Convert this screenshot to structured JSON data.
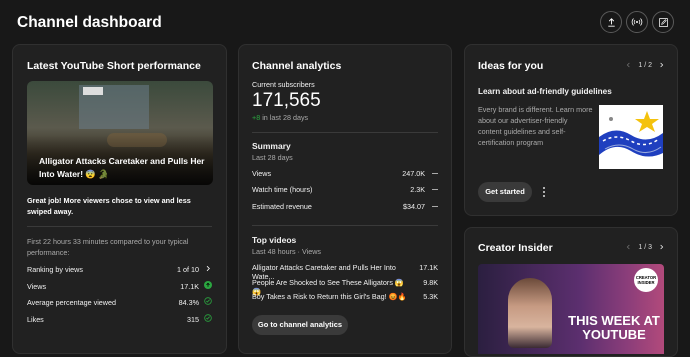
{
  "header": {
    "title": "Channel dashboard",
    "buttons": [
      "upload-icon",
      "live-icon",
      "edit-icon"
    ]
  },
  "short": {
    "title": "Latest YouTube Short performance",
    "thumbnail_caption": "Alligator Attacks Caretaker and Pulls Her Into Water! 😨 🐊",
    "summary": "Great job! More viewers chose to view and less swiped away.",
    "compare": "First 22 hours 33 minutes compared to your typical performance:",
    "stats": [
      {
        "label": "Ranking by views",
        "value": "1 of 10"
      },
      {
        "label": "Views",
        "value": "17.1K"
      },
      {
        "label": "Average percentage viewed",
        "value": "84.3%"
      },
      {
        "label": "Likes",
        "value": "315"
      }
    ]
  },
  "analytics": {
    "title": "Channel analytics",
    "subs_label": "Current subscribers",
    "subs_value": "171,565",
    "subs_change": "+8",
    "subs_period": "in last 28 days",
    "summary_title": "Summary",
    "summary_period": "Last 28 days",
    "summary_rows": [
      {
        "label": "Views",
        "value": "247.0K"
      },
      {
        "label": "Watch time (hours)",
        "value": "2.3K"
      },
      {
        "label": "Estimated revenue",
        "value": "$34.07"
      }
    ],
    "top_title": "Top videos",
    "top_period": "Last 48 hours · Views",
    "top_rows": [
      {
        "label": "Alligator Attacks Caretaker and Pulls Her Into Wate...",
        "value": "17.1K"
      },
      {
        "label": "People Are Shocked to See These Alligators 😱😱",
        "value": "9.8K"
      },
      {
        "label": "Boy Takes a Risk to Return this Girl's Bag! 😡🔥",
        "value": "5.3K"
      }
    ],
    "button": "Go to channel analytics"
  },
  "ideas": {
    "title": "Ideas for you",
    "pager": "1 / 2",
    "heading": "Learn about ad-friendly guidelines",
    "body": "Every brand is different. Learn more about our advertiser-friendly content guidelines and self-certification program",
    "button": "Get started"
  },
  "insider": {
    "title": "Creator Insider",
    "pager": "1 / 3",
    "badge": "CREATOR INSIDER",
    "banner": "THIS WEEK AT YOUTUBE"
  },
  "colors": {
    "background": "#181818",
    "card": "#212121",
    "positive": "#2ba640",
    "accent": "#3ea6ff"
  }
}
